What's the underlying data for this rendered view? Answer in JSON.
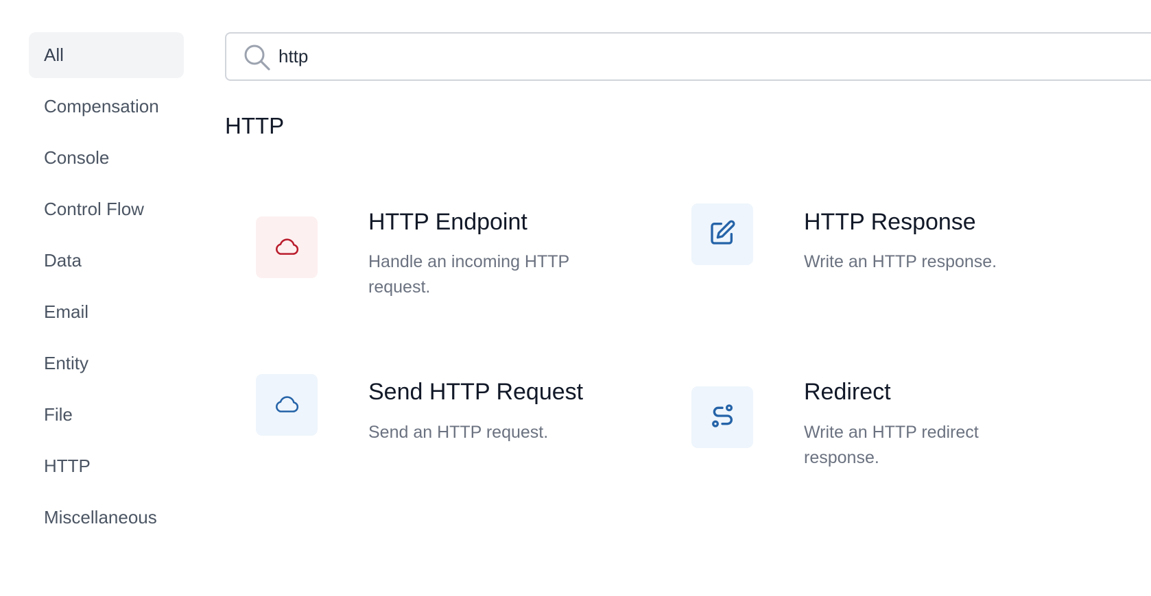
{
  "sidebar": {
    "categories": [
      {
        "label": "All",
        "active": true
      },
      {
        "label": "Compensation"
      },
      {
        "label": "Console"
      },
      {
        "label": "Control Flow"
      },
      {
        "label": "Data"
      },
      {
        "label": "Email"
      },
      {
        "label": "Entity"
      },
      {
        "label": "File"
      },
      {
        "label": "HTTP"
      },
      {
        "label": "Miscellaneous"
      }
    ]
  },
  "search": {
    "value": "http",
    "icon": "search-icon"
  },
  "section": {
    "title": "HTTP"
  },
  "activities": [
    {
      "title": "HTTP Endpoint",
      "description": "Handle an incoming HTTP request.",
      "icon": "cloud-icon",
      "icon_color": "#b91c2c",
      "tile_color": "#fdf0f0"
    },
    {
      "title": "HTTP Response",
      "description": "Write an HTTP response.",
      "icon": "edit-icon",
      "icon_color": "#2563a8",
      "tile_color": "#eef5fc"
    },
    {
      "title": "Send HTTP Request",
      "description": "Send an HTTP request.",
      "icon": "cloud-icon",
      "icon_color": "#2563a8",
      "tile_color": "#eef5fc"
    },
    {
      "title": "Redirect",
      "description": "Write an HTTP redirect response.",
      "icon": "route-icon",
      "icon_color": "#2563a8",
      "tile_color": "#eef5fc"
    }
  ]
}
